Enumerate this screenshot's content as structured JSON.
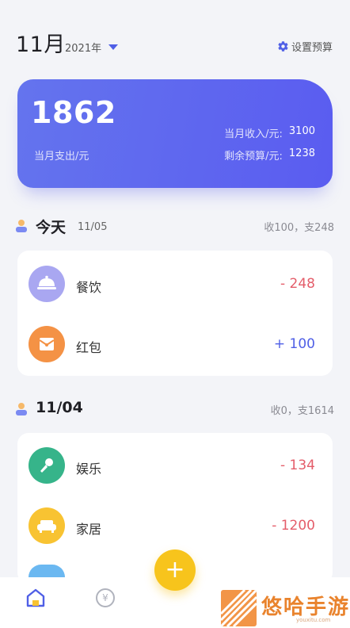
{
  "header": {
    "month": "11月",
    "year": "2021年",
    "budget_button": "设置预算"
  },
  "summary": {
    "spent": "1862",
    "spent_label": "当月支出/元",
    "income_label": "当月收入/元:",
    "income": "3100",
    "remaining_label": "剩余预算/元:",
    "remaining": "1238"
  },
  "days": [
    {
      "title": "今天",
      "date": "11/05",
      "summary": "收100，支248",
      "items": [
        {
          "name": "餐饮",
          "amount": "- 248",
          "icon": "food-icon",
          "color": "#a9a7f1"
        },
        {
          "name": "红包",
          "amount": "+ 100",
          "icon": "red-envelope-icon",
          "color": "#f49245"
        }
      ]
    },
    {
      "title": "11/04",
      "summary": "收0，支1614",
      "items": [
        {
          "name": "娱乐",
          "amount": "- 134",
          "icon": "microphone-icon",
          "color": "#36b48a"
        },
        {
          "name": "家居",
          "amount": "- 1200",
          "icon": "sofa-icon",
          "color": "#f8c332"
        }
      ]
    }
  ],
  "tabbar": {
    "add_label": "+",
    "yen_symbol": "¥"
  },
  "watermark": {
    "text": "悠哈手游",
    "url": "youxitu.com"
  }
}
